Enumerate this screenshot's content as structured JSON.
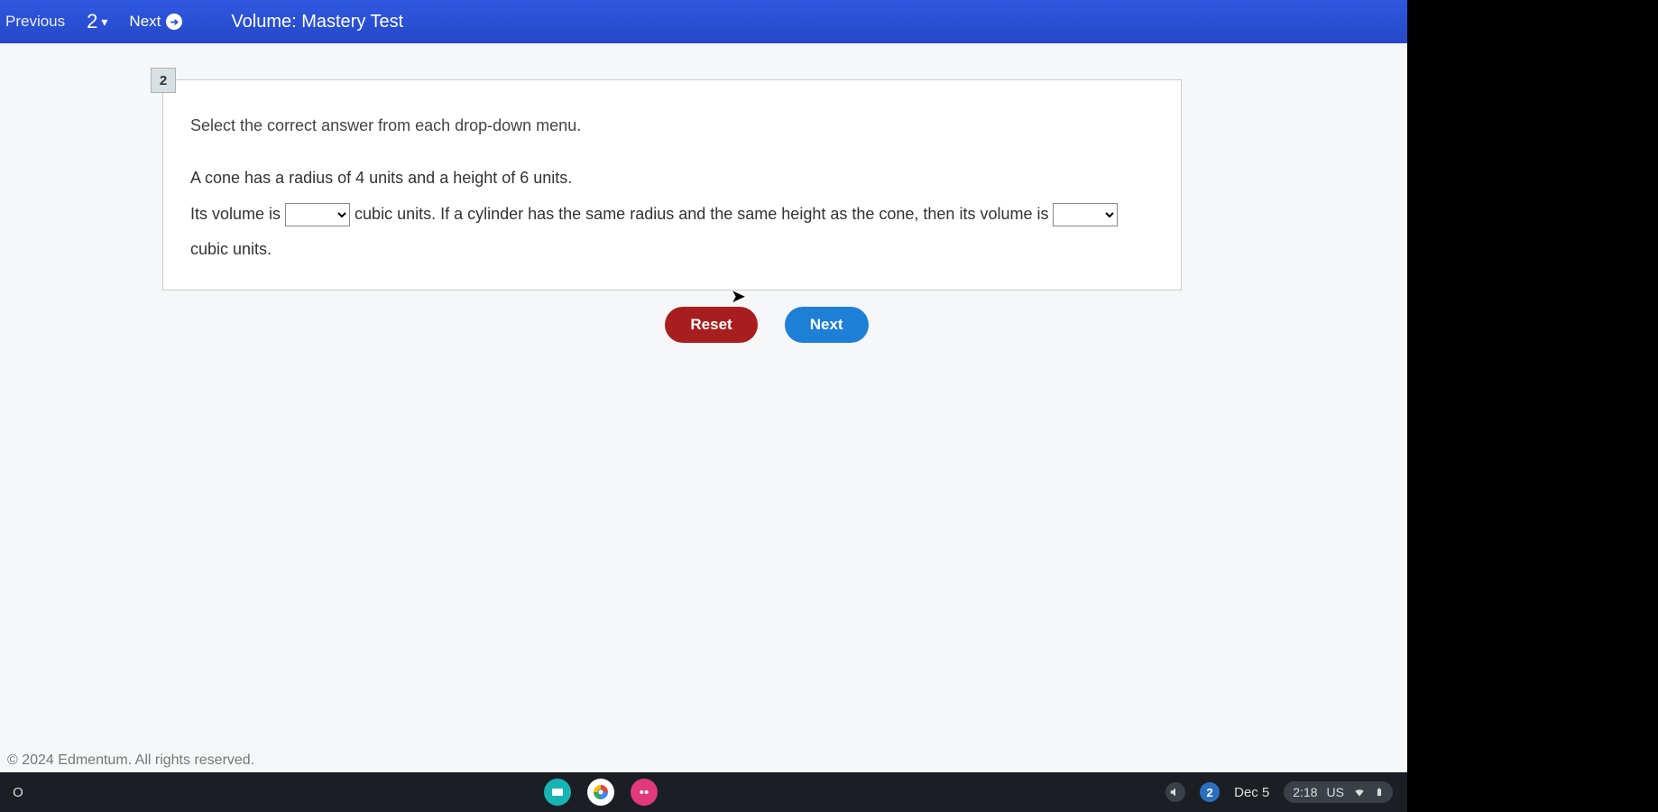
{
  "topbar": {
    "previous": "Previous",
    "question_number": "2",
    "next": "Next",
    "title": "Volume: Mastery Test"
  },
  "question": {
    "badge": "2",
    "instruction": "Select the correct answer from each drop-down menu.",
    "line1": "A cone has a radius of 4 units and a height of 6 units.",
    "line2_a": "Its volume is ",
    "line2_b": " cubic units. If a cylinder has the same radius and the same height as the cone, then its volume is ",
    "line3": "cubic units."
  },
  "buttons": {
    "reset": "Reset",
    "next": "Next"
  },
  "footer": {
    "copyright": "© 2024 Edmentum. All rights reserved."
  },
  "shelf": {
    "launcher": "O",
    "notification_count": "2",
    "date": "Dec 5",
    "time": "2:18",
    "locale": "US"
  }
}
